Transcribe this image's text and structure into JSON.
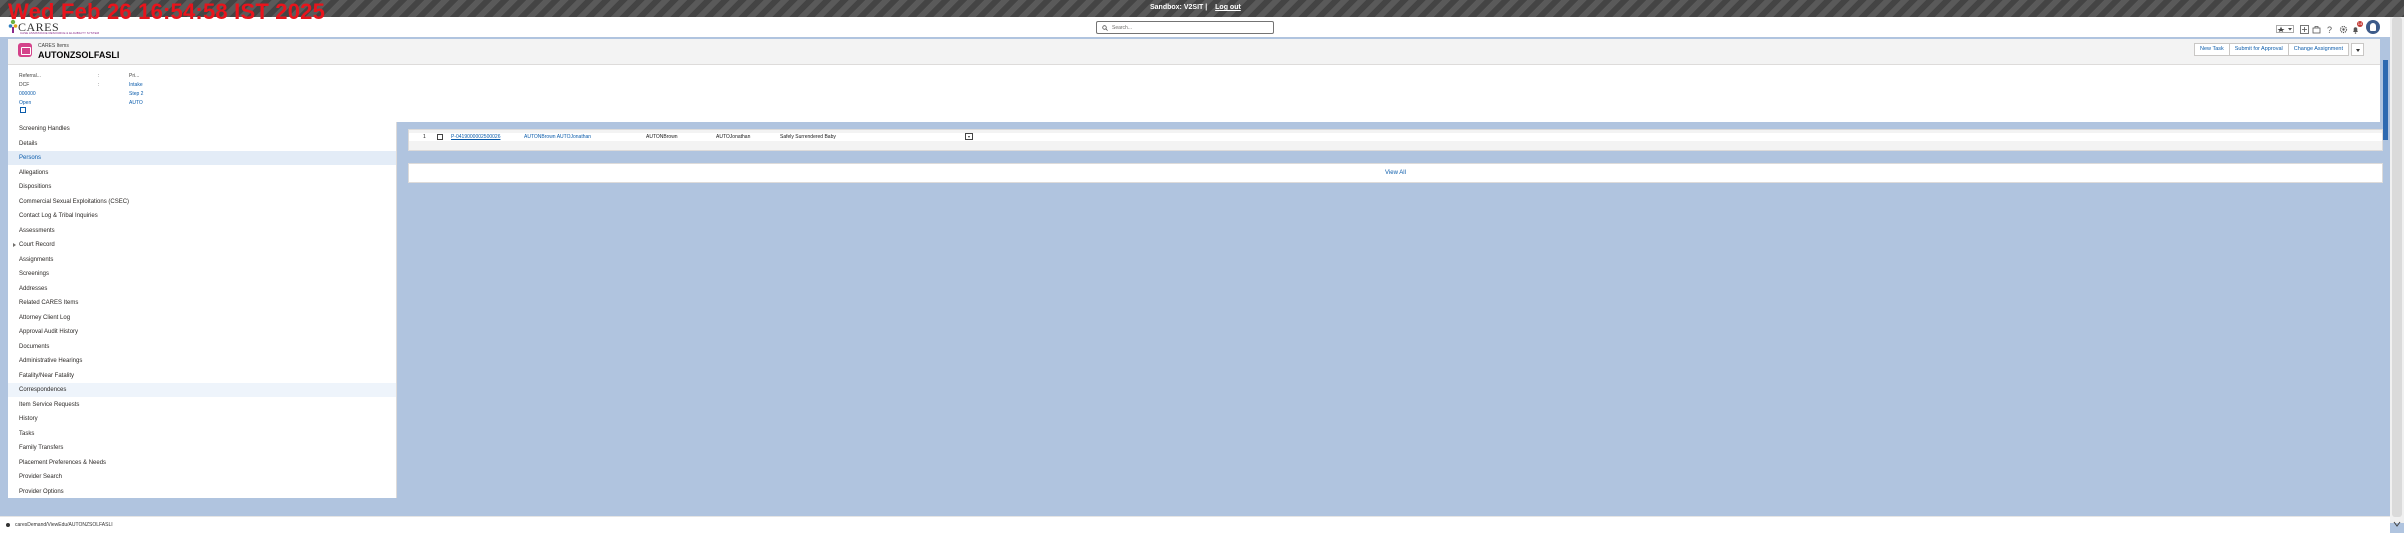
{
  "overlay": {
    "timestamp": "Wed Feb 26 16:54:58 IST 2025"
  },
  "sandbox": {
    "label": "Sandbox: V2SIT |",
    "logout": "Log out"
  },
  "header": {
    "logo_text": "CARES",
    "logo_subtext": "CASE ASSISTANCE RESOURCE & ELIGIBILITY SYSTEM",
    "search_placeholder": "Search...",
    "notification_count": "14"
  },
  "record": {
    "type_label": "CARES Items",
    "name": "AUTONZSOLFASLI",
    "actions": [
      "New Task",
      "Submit for Approval",
      "Change Assignment"
    ]
  },
  "highlights": {
    "col1": [
      "Referral...",
      "DCF",
      "000000",
      "Open"
    ],
    "col2": [
      ":",
      ":"
    ],
    "col3": [
      "Pri...",
      "Intake",
      "Step 2",
      "AUTO"
    ]
  },
  "nav": {
    "items": [
      "Screening Handles",
      "Details",
      "Persons",
      "Allegations",
      "Dispositions",
      "Commercial Sexual Exploitations (CSEC)",
      "Contact Log & Tribal Inquiries",
      "Assessments",
      "Court Record",
      "Assignments",
      "Screenings",
      "Addresses",
      "Related CARES Items",
      "Attorney Client Log",
      "Approval Audit History",
      "Documents",
      "Administrative Hearings",
      "Fatality/Near Fatality",
      "Correspondences",
      "Item Service Requests",
      "History",
      "Tasks",
      "Family Transfers",
      "Placement Preferences & Needs",
      "Provider Search",
      "Provider Options"
    ]
  },
  "related": {
    "row": {
      "num": "1",
      "id": "P-0419000002500026",
      "name": "AUTONBrown AUTOJonathan",
      "first": "AUTONBrown",
      "last": "AUTOJonathan",
      "role": "Safely Surrendered Baby"
    },
    "view_all": "View All"
  },
  "status_bar": {
    "url": "caresDemand/ViewEdu/AUTONZSOLFASLI"
  }
}
